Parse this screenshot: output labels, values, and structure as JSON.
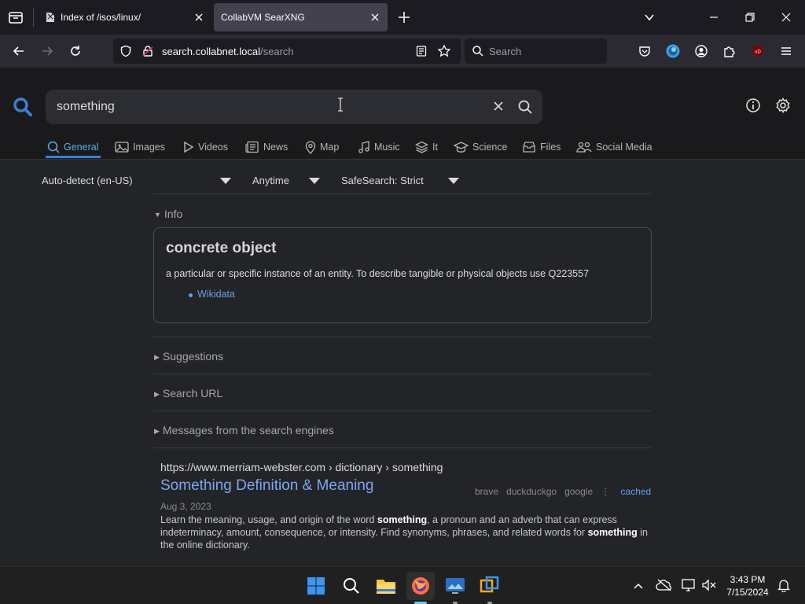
{
  "browser": {
    "tabs": [
      {
        "title": "Index of /isos/linux/",
        "active": false
      },
      {
        "title": "CollabVM SearXNG",
        "active": true
      }
    ],
    "url": {
      "domain": "search.collabnet.local",
      "path": "/search"
    },
    "search_placeholder": "Search"
  },
  "search": {
    "query": "something",
    "categories": [
      {
        "label": "General",
        "icon": "search-icon"
      },
      {
        "label": "Images",
        "icon": "image-icon"
      },
      {
        "label": "Videos",
        "icon": "play-icon"
      },
      {
        "label": "News",
        "icon": "newspaper-icon"
      },
      {
        "label": "Map",
        "icon": "map-pin-icon"
      },
      {
        "label": "Music",
        "icon": "music-note-icon"
      },
      {
        "label": "It",
        "icon": "layers-icon"
      },
      {
        "label": "Science",
        "icon": "mortarboard-icon"
      },
      {
        "label": "Files",
        "icon": "file-box-icon"
      },
      {
        "label": "Social Media",
        "icon": "people-icon"
      }
    ],
    "filters": {
      "language": "Auto-detect (en-US)",
      "time": "Anytime",
      "safesearch": "SafeSearch: Strict"
    }
  },
  "sidebar": {
    "info_label": "Info",
    "suggestions_label": "Suggestions",
    "search_url_label": "Search URL",
    "messages_label": "Messages from the search engines"
  },
  "infobox": {
    "title": "concrete object",
    "description": "a particular or specific instance of an entity. To describe tangible or physical objects use Q223557",
    "link": "Wikidata"
  },
  "results": [
    {
      "url": "https://www.merriam-webster.com  › dictionary › something",
      "title": "Something Definition & Meaning",
      "date": "Aug 3, 2023",
      "snippet_parts": [
        "Learn the meaning, usage, and origin of the word ",
        "something",
        ", a pronoun and an adverb that can express indeterminacy, amount, consequence, or intensity. Find synonyms, phrases, and related words for ",
        "something",
        " in the online dictionary."
      ],
      "engines": [
        "brave",
        "duckduckgo",
        "google"
      ],
      "cached_label": "cached"
    }
  ],
  "taskbar": {
    "time": "3:43 PM",
    "date": "7/15/2024"
  },
  "colors": {
    "accent": "#3d7fd6",
    "link": "#7ea7f0",
    "tab_active": "#42414d"
  }
}
